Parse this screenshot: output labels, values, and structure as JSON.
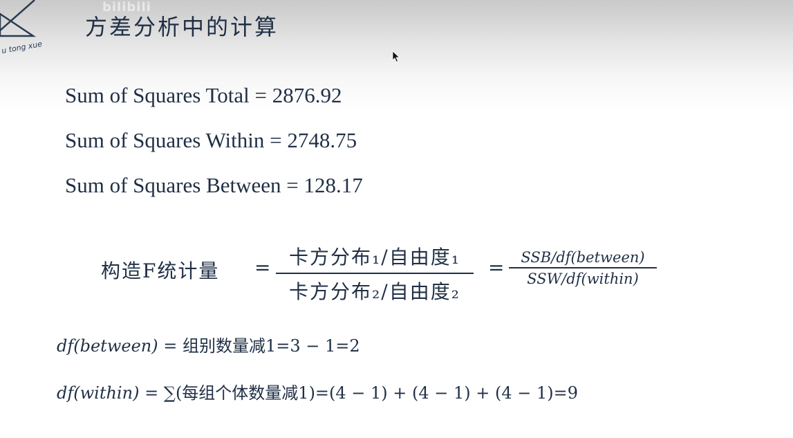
{
  "watermark": "bilibili",
  "logo": {
    "text": "u tong xue"
  },
  "title": "方差分析中的计算",
  "sums": {
    "total": "Sum of Squares Total = 2876.92",
    "within": "Sum of Squares Within = 2748.75",
    "between": "Sum of Squares Between = 128.17"
  },
  "f_statistic": {
    "label": "构造F统计量",
    "eq": "=",
    "numerator": "卡方分布₁/自由度₁",
    "denominator": "卡方分布₂/自由度₂",
    "numerator2": "SSB/df(between)",
    "denominator2": "SSW/df(within)"
  },
  "df_between": {
    "lhs": "df(between)",
    "rhs": " = 组别数量减1=3 − 1=2"
  },
  "df_within": {
    "lhs": "df(within)",
    "rhs": " = ∑(每组个体数量减1)=(4 − 1) + (4 − 1) + (4 − 1)=9"
  }
}
